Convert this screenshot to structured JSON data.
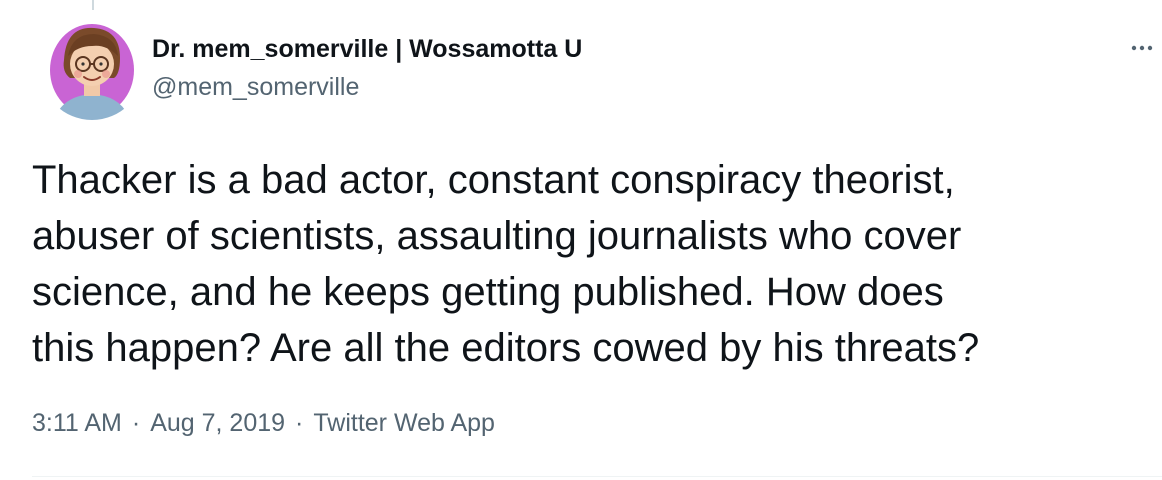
{
  "tweet": {
    "author": {
      "display_name": "Dr. mem_somerville | Wossamotta U",
      "handle": "@mem_somerville"
    },
    "more_icon": "more-horizontal-icon",
    "text": "Thacker is a bad actor, constant conspiracy theorist,\nabuser of scientists, assaulting journalists who cover\nscience, and he keeps getting published. How does\nthis happen? Are all the editors cowed by his threats?",
    "meta": {
      "time": "3:11 AM",
      "separator": "·",
      "date": "Aug 7, 2019",
      "source": "Twitter Web App"
    }
  },
  "colors": {
    "text_primary": "#0f1419",
    "text_secondary": "#536471",
    "avatar_bg": "#c964d4",
    "divider": "#eff3f4"
  }
}
